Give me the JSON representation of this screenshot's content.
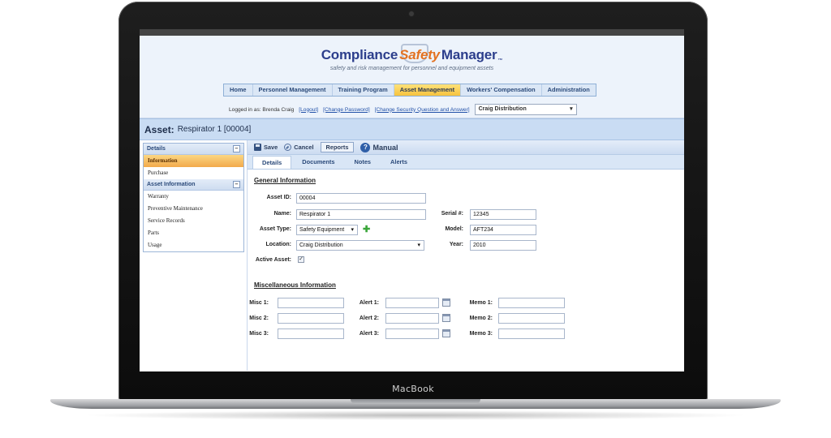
{
  "device": {
    "brand": "MacBook"
  },
  "app": {
    "logo": {
      "part1": "Compliance",
      "part2": "Safety",
      "part3": "Manager",
      "tm": "™"
    },
    "tagline": "safety and risk management for personnel and equipment assets",
    "nav": [
      {
        "label": "Home"
      },
      {
        "label": "Personnel Management"
      },
      {
        "label": "Training Program"
      },
      {
        "label": "Asset Management",
        "active": true
      },
      {
        "label": "Workers' Compensation"
      },
      {
        "label": "Administration"
      }
    ],
    "login": {
      "logged_in_as": "Logged in as: Brenda Craig",
      "logout": "[Logout]",
      "change_password": "[Change Password]",
      "change_security": "[Change Security Question and Answer]",
      "organization": "Craig Distribution"
    }
  },
  "asset": {
    "label": "Asset:",
    "name": "Respirator 1 [00004]"
  },
  "sidebar": {
    "details_header": "Details",
    "details_items": [
      "Information",
      "Purchase"
    ],
    "asset_info_header": "Asset Information",
    "asset_info_items": [
      "Warranty",
      "Preventive Maintenance",
      "Service Records",
      "Parts",
      "Usage"
    ],
    "collapse_glyph": "–"
  },
  "toolbar": {
    "save": "Save",
    "cancel": "Cancel",
    "reports": "Reports",
    "manual": "Manual",
    "manual_glyph": "?"
  },
  "tabs": [
    "Details",
    "Documents",
    "Notes",
    "Alerts"
  ],
  "general": {
    "title": "General Information",
    "asset_id_label": "Asset ID:",
    "asset_id": "00004",
    "name_label": "Name:",
    "name": "Respirator 1",
    "asset_type_label": "Asset Type:",
    "asset_type": "Safety Equipment",
    "location_label": "Location:",
    "location": "Craig Distribution",
    "active_label": "Active Asset:",
    "active_check": "✓",
    "serial_label": "Serial #:",
    "serial": "12345",
    "model_label": "Model:",
    "model": "AFT234",
    "year_label": "Year:",
    "year": "2010",
    "plus_glyph": "✚"
  },
  "misc": {
    "title": "Miscellaneous Information",
    "misc_labels": [
      "Misc 1:",
      "Misc 2:",
      "Misc 3:"
    ],
    "alert_labels": [
      "Alert 1:",
      "Alert 2:",
      "Alert 3:"
    ],
    "memo_labels": [
      "Memo 1:",
      "Memo 2:",
      "Memo 3:"
    ]
  }
}
